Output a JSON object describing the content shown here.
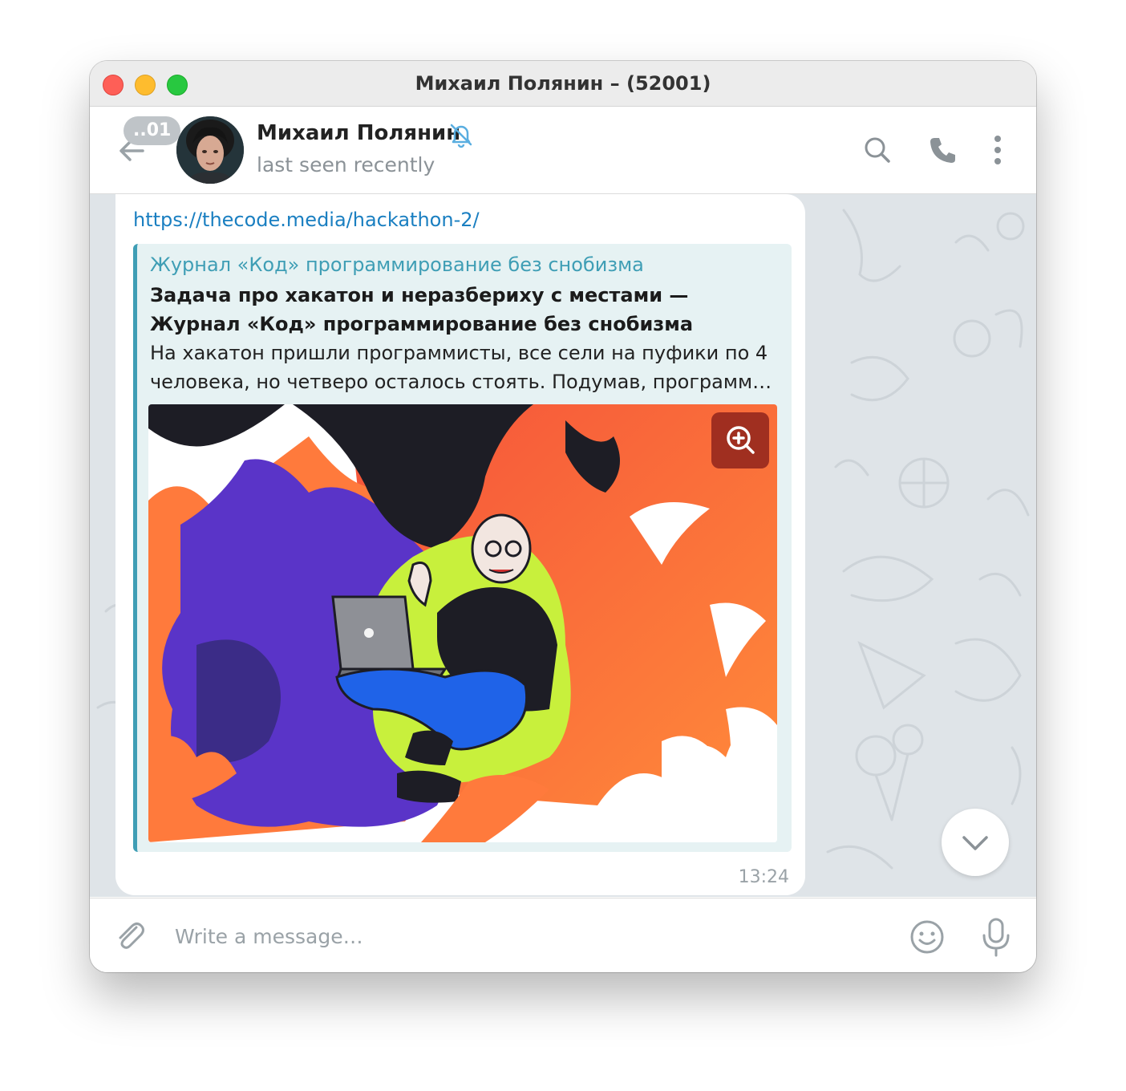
{
  "window": {
    "title": "Михаил Полянин – (52001)"
  },
  "header": {
    "unread_badge": "..01",
    "contact_name": "Михаил Полянин",
    "status": "last seen recently",
    "icons": [
      "back-arrow-icon",
      "muted-bell-icon",
      "search-icon",
      "phone-icon",
      "more-vertical-icon"
    ]
  },
  "message": {
    "link": "https://thecode.media/hackathon-2/",
    "preview": {
      "site_name": "Журнал «Код» программирование без снобизма",
      "title": "Задача про хакатон и неразбериху с местами — Журнал «Код» программирование без снобизма",
      "description": "На хакатон пришли программисты, все сели на пуфики по 4 человека, но четверо осталось стоять. Подумав, программ…"
    },
    "time": "13:24"
  },
  "composer": {
    "placeholder": "Write a message…",
    "icons": [
      "paperclip-icon",
      "emoji-icon",
      "microphone-icon"
    ]
  },
  "colors": {
    "accent": "#3f9eb5",
    "link": "#1a7fc1",
    "chat_background": "#dfe4e8",
    "preview_background": "#e6f2f3"
  }
}
